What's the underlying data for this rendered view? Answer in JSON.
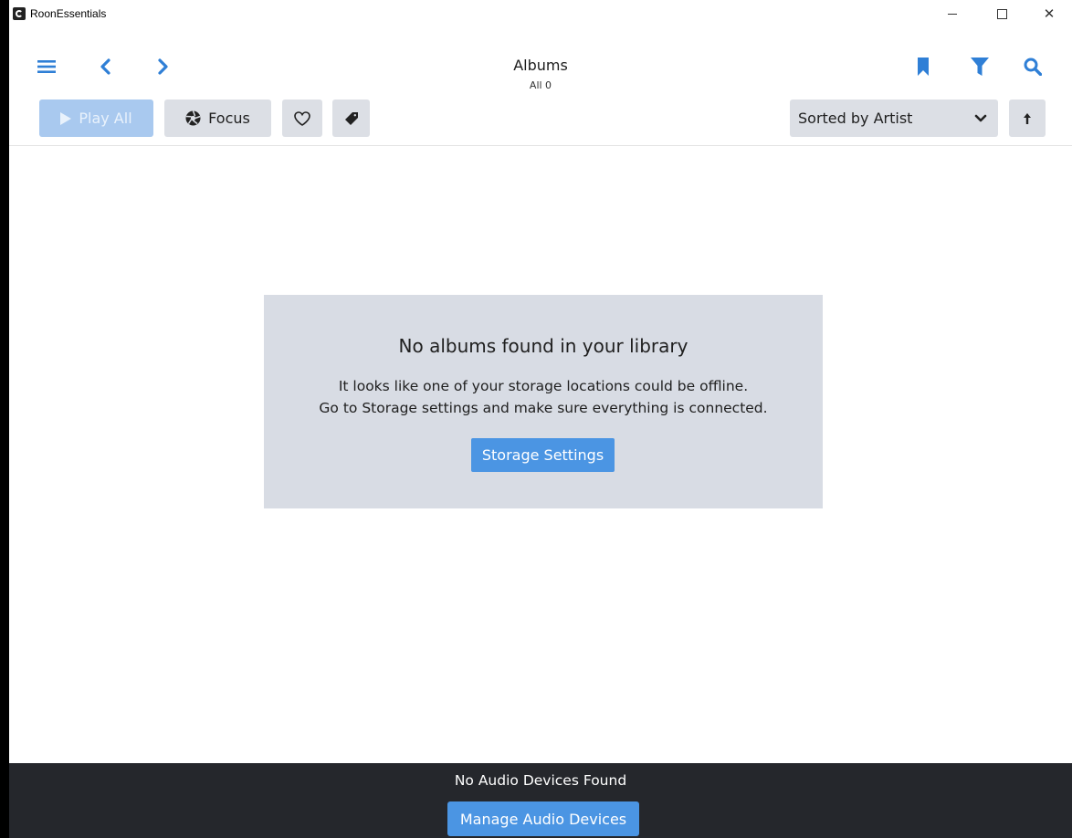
{
  "window": {
    "title": "RoonEssentials",
    "controls": {
      "minimize": "minimize",
      "maximize": "maximize",
      "close": "✕"
    }
  },
  "nav": {
    "title": "Albums",
    "subtitle": "All 0",
    "icons": [
      "menu-icon",
      "back-icon",
      "forward-icon",
      "bookmark-icon",
      "filter-icon",
      "search-icon"
    ]
  },
  "toolbar": {
    "play_all_label": "Play All",
    "focus_label": "Focus",
    "sort_label": "Sorted by Artist"
  },
  "empty_state": {
    "title": "No albums found in your library",
    "line1": "It looks like one of your storage locations could be offline.",
    "line2": "Go to Storage settings and make sure everything is connected.",
    "button_label": "Storage Settings"
  },
  "footer": {
    "message": "No Audio Devices Found",
    "button_label": "Manage Audio Devices"
  },
  "colors": {
    "accent": "#4b95e3",
    "nav_icon": "#2f7fd6",
    "panel": "#d8dce4",
    "footer_bg": "#25272c",
    "button_bg": "#dcdfe5",
    "disabled_button": "#a9c9ef"
  }
}
